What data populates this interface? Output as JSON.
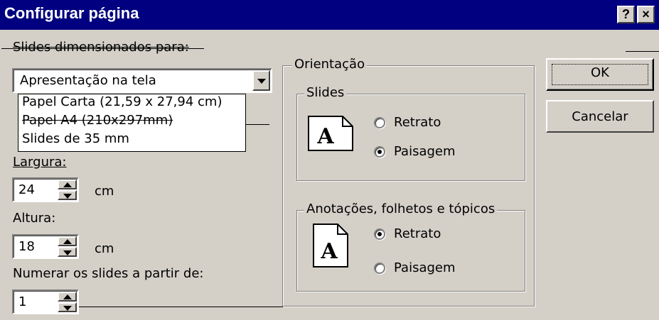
{
  "dialog": {
    "title": "Configurar página",
    "help_label": "?",
    "close_label": "×"
  },
  "slides_size": {
    "label": "Slides dimensionados para:",
    "selected": "Apresentação na tela",
    "options": [
      "Papel Carta (21,59 x 27,94 cm)",
      "Papel A4 (210x297mm)",
      "Slides de 35 mm"
    ]
  },
  "width": {
    "label": "Largura:",
    "value": "24",
    "unit": "cm"
  },
  "height": {
    "label": "Altura:",
    "value": "18",
    "unit": "cm"
  },
  "numbering": {
    "label": "Numerar os slides a partir de:",
    "value": "1"
  },
  "orientation": {
    "label": "Orientação",
    "slides": {
      "label": "Slides",
      "portrait": "Retrato",
      "landscape": "Paisagem",
      "selected": "landscape"
    },
    "notes": {
      "label": "Anotações, folhetos e  tópicos",
      "portrait": "Retrato",
      "landscape": "Paisagem",
      "selected": "portrait"
    },
    "page_glyph": "A"
  },
  "buttons": {
    "ok": "OK",
    "cancel": "Cancelar"
  }
}
